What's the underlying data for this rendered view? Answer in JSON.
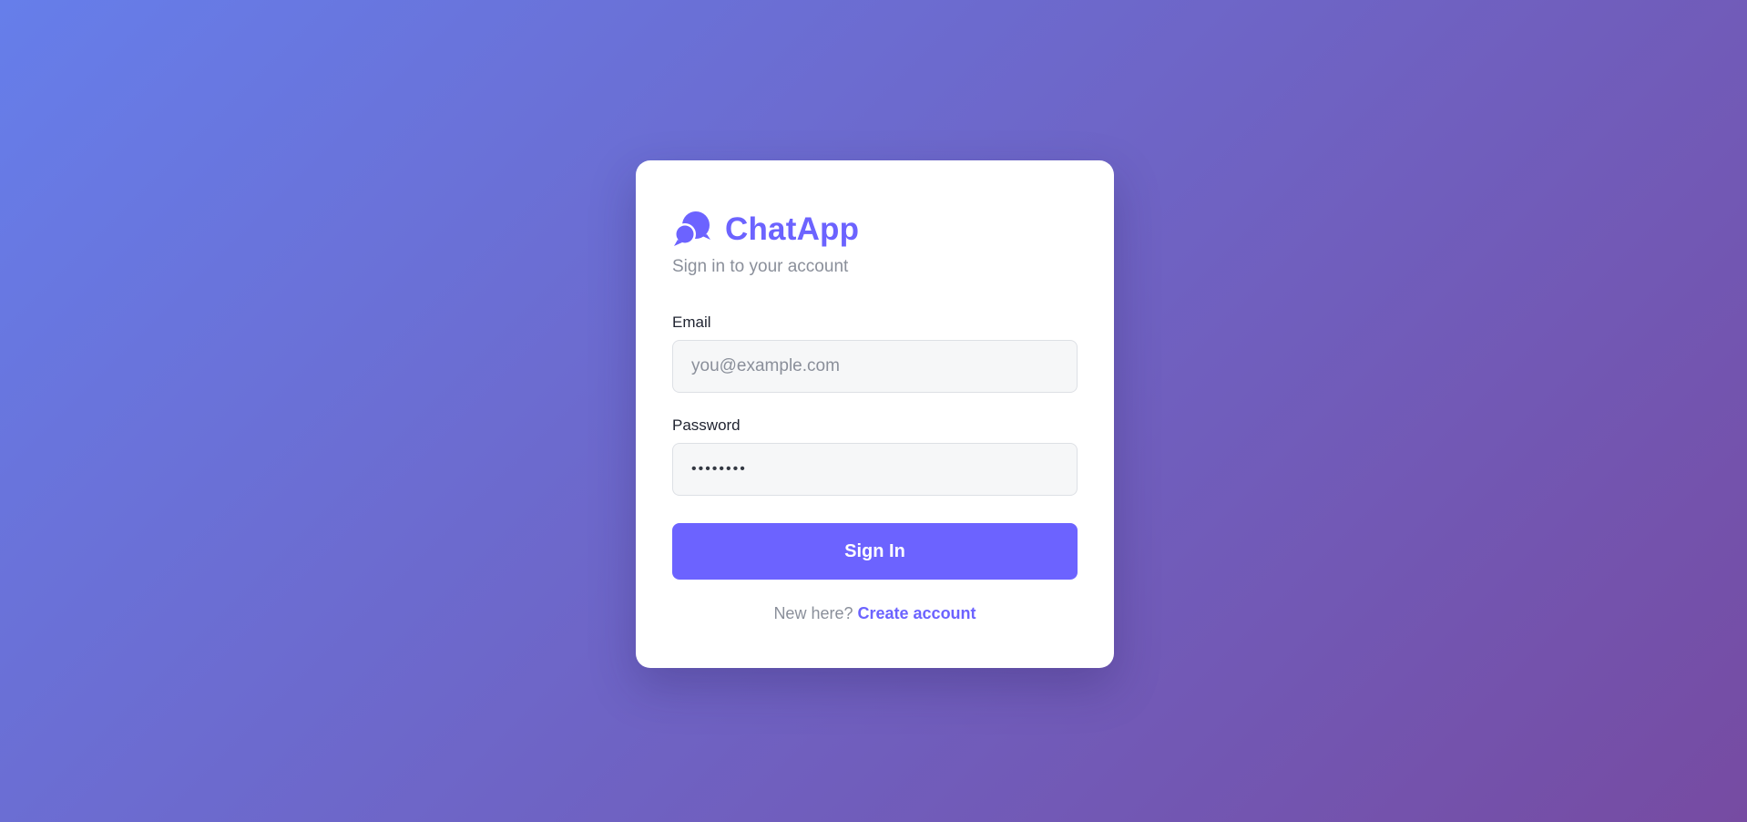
{
  "app": {
    "title": "ChatApp",
    "subtitle": "Sign in to your account",
    "icon": "chat-bubbles-icon"
  },
  "form": {
    "email_label": "Email",
    "email_placeholder": "you@example.com",
    "email_value": "",
    "password_label": "Password",
    "password_value": "12345678",
    "submit_label": "Sign In"
  },
  "footer": {
    "prompt": "New here?",
    "link_label": "Create account"
  },
  "colors": {
    "accent": "#6c63ff",
    "background_start": "#667eea",
    "background_end": "#764ba2"
  }
}
